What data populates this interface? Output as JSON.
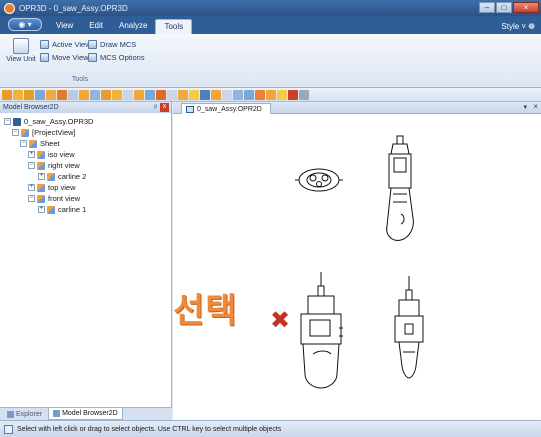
{
  "window": {
    "title": "OPR3D - 0_saw_Assy.OPR3D"
  },
  "menu": {
    "app_button": "◉ ▾",
    "tabs": [
      "View",
      "Edit",
      "Analyze",
      "Tools"
    ],
    "style": "Style ˅ ❁"
  },
  "ribbon": {
    "view_unit": "View Unit",
    "buttons": [
      "Active View",
      "Draw MCS",
      "Move View",
      "MCS Options"
    ],
    "group_label": "Tools"
  },
  "toolbar": {
    "icon_colors": [
      "#e99a2a",
      "#f2b23c",
      "#e0a030",
      "#7aa8d8",
      "#f0a840",
      "#e37c2a",
      "#b9c9de",
      "#f2a63a",
      "#8fb4e0",
      "#e89b30",
      "#f2b23c",
      "#c9d6e6",
      "#f2a63a",
      "#7aa8d8",
      "#e06a2a",
      "#c9d6e6",
      "#f0a840",
      "#f7c84a",
      "#4f7fc0",
      "#f2a63a",
      "#c9d6e6",
      "#8fb4e0",
      "#7aa8d8",
      "#e8823a",
      "#f2a63a",
      "#f7c84a",
      "#c8402c",
      "#9aa8bb"
    ]
  },
  "model_browser": {
    "header": "Model Browser2D",
    "pin": "ᵖ",
    "close": "x",
    "tree": [
      {
        "label": "0_saw_Assy.OPR3D",
        "expander": "−",
        "icon": "root"
      },
      {
        "label": "[ProjectView]",
        "expander": "−",
        "icon": "view"
      },
      {
        "label": "Sheet",
        "expander": "−",
        "icon": "view"
      },
      {
        "label": "iso view",
        "expander": "+",
        "icon": "view"
      },
      {
        "label": "right view",
        "expander": "−",
        "icon": "view"
      },
      {
        "label": "carline 2",
        "expander": "+",
        "icon": "view"
      },
      {
        "label": "top view",
        "expander": "+",
        "icon": "view"
      },
      {
        "label": "front view",
        "expander": "−",
        "icon": "view"
      },
      {
        "label": "carline 1",
        "expander": "+",
        "icon": "view"
      }
    ],
    "bottom_tabs": [
      "Explorer",
      "Model Browser2D"
    ]
  },
  "document": {
    "tab_title": "0_saw_Assy.OPR2D",
    "menu_glyph": "▾",
    "close_glyph": "×"
  },
  "status": {
    "text": "Select with left click or drag to select objects. Use CTRL key to select multiple objects"
  },
  "annotation": {
    "text": "선택",
    "mark": "✖",
    "color": "#f08a3a"
  }
}
